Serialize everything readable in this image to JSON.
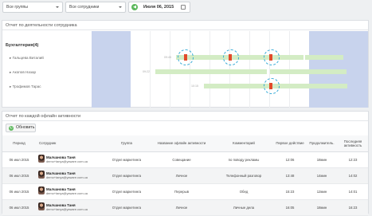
{
  "filters": {
    "groups": "Все группы",
    "employees": "Все сотрудники",
    "date": "Июля 06, 2015"
  },
  "activity_panel": {
    "title": "Отчет по деятельности сотрудника",
    "group": "Бухгалтерия(4)",
    "employees": [
      "Гальцева Виталий",
      "Акопов Назар",
      "Трофимов Тарас"
    ],
    "times": [
      "09:45",
      "09:22",
      "10:15"
    ]
  },
  "offline_panel": {
    "title": "Отчет по каждой офлайн активности",
    "refresh_label": "Обновить",
    "columns": [
      "Период",
      "Сотрудник",
      "Группа",
      "Название офлайн активности",
      "Комментарий",
      "Первое действие",
      "Продолжитель.",
      "Последняя активность"
    ],
    "rows": [
      {
        "period": "06 июл 2015",
        "name": "Малчанова Таня",
        "email": "demo+tanya@yaware.com.ua",
        "group": "Отдел маркетинга",
        "activity": "Совещание",
        "comment": "по поводу рекламы",
        "first": "12:06",
        "duration": "18мин",
        "last": "12:23"
      },
      {
        "period": "06 июл 2015",
        "name": "Малчанова Таня",
        "email": "demo+tanya@yaware.com.ua",
        "group": "Отдел маркетинга",
        "activity": "Личное",
        "comment": "Телефонный разговор",
        "first": "13:48",
        "duration": "14мин",
        "last": "14:02"
      },
      {
        "period": "06 июл 2015",
        "name": "Малчанова Таня",
        "email": "demo+tanya@yaware.com.ua",
        "group": "Отдел маркетинга",
        "activity": "Перерыв",
        "comment": "Обед",
        "first": "15:23",
        "duration": "12мин",
        "last": "14:01"
      },
      {
        "period": "06 июл 2015",
        "name": "Малчанова Таня",
        "email": "demo+tanya@yaware.com.ua",
        "group": "Отдел маркетинга",
        "activity": "Личное",
        "comment": "Личные дела",
        "first": "16:05",
        "duration": "18мин",
        "last": "16:23"
      }
    ]
  },
  "colors": {
    "green_bar": "#d3ecc4",
    "offline_marker": "#e24b2b",
    "off_hours": "#c8d3ed",
    "highlight_ring": "#33a9d6"
  }
}
